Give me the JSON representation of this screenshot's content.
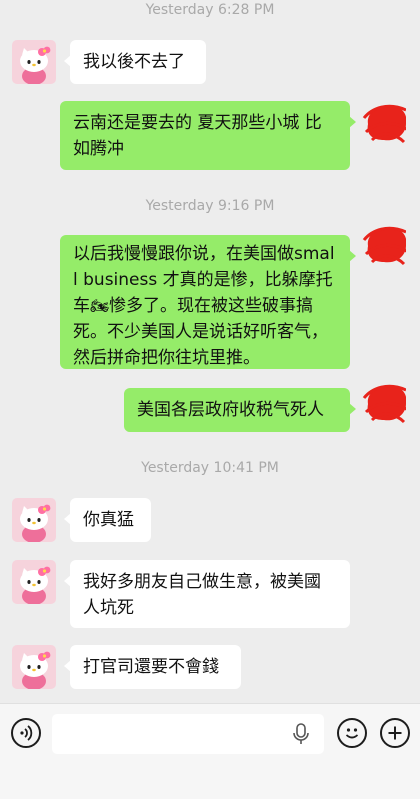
{
  "messages": [
    {
      "type": "timestamp",
      "text": "Yesterday 6:28 PM"
    },
    {
      "type": "message",
      "side": "left",
      "text": "我以後不去了"
    },
    {
      "type": "message",
      "side": "right",
      "text": "云南还是要去的 夏天那些小城 比如腾冲"
    },
    {
      "type": "timestamp",
      "text": "Yesterday 9:16 PM"
    },
    {
      "type": "message",
      "side": "right",
      "text_before": "以后我慢慢跟你说，在美国做small business 才真的是惨，比躲摩托车",
      "emoji": "🏍",
      "text_after": "惨多了。现在被这些破事搞死。不少美国人是说话好听客气，然后拼命把你往坑里推。"
    },
    {
      "type": "message",
      "side": "right",
      "text": "美国各层政府收税气死人"
    },
    {
      "type": "timestamp",
      "text": "Yesterday 10:41 PM"
    },
    {
      "type": "message",
      "side": "left",
      "text": "你真猛"
    },
    {
      "type": "message",
      "side": "left",
      "text": "我好多朋友自己做生意，被美國人坑死"
    },
    {
      "type": "message",
      "side": "left",
      "text": "打官司還要不會錢"
    }
  ],
  "input_bar": {
    "voice_icon": "voice-icon",
    "input_value": "",
    "mic_icon": "microphone-icon",
    "emoji_icon": "emoji-icon",
    "add_icon": "add-icon"
  },
  "colors": {
    "background": "#ededed",
    "outgoing_bubble": "#95ec69",
    "incoming_bubble": "#ffffff",
    "timestamp": "#a9a9a9",
    "redaction": "#e8231b"
  },
  "avatars": {
    "left": "hello-kitty-avatar",
    "right": "redacted-avatar"
  }
}
